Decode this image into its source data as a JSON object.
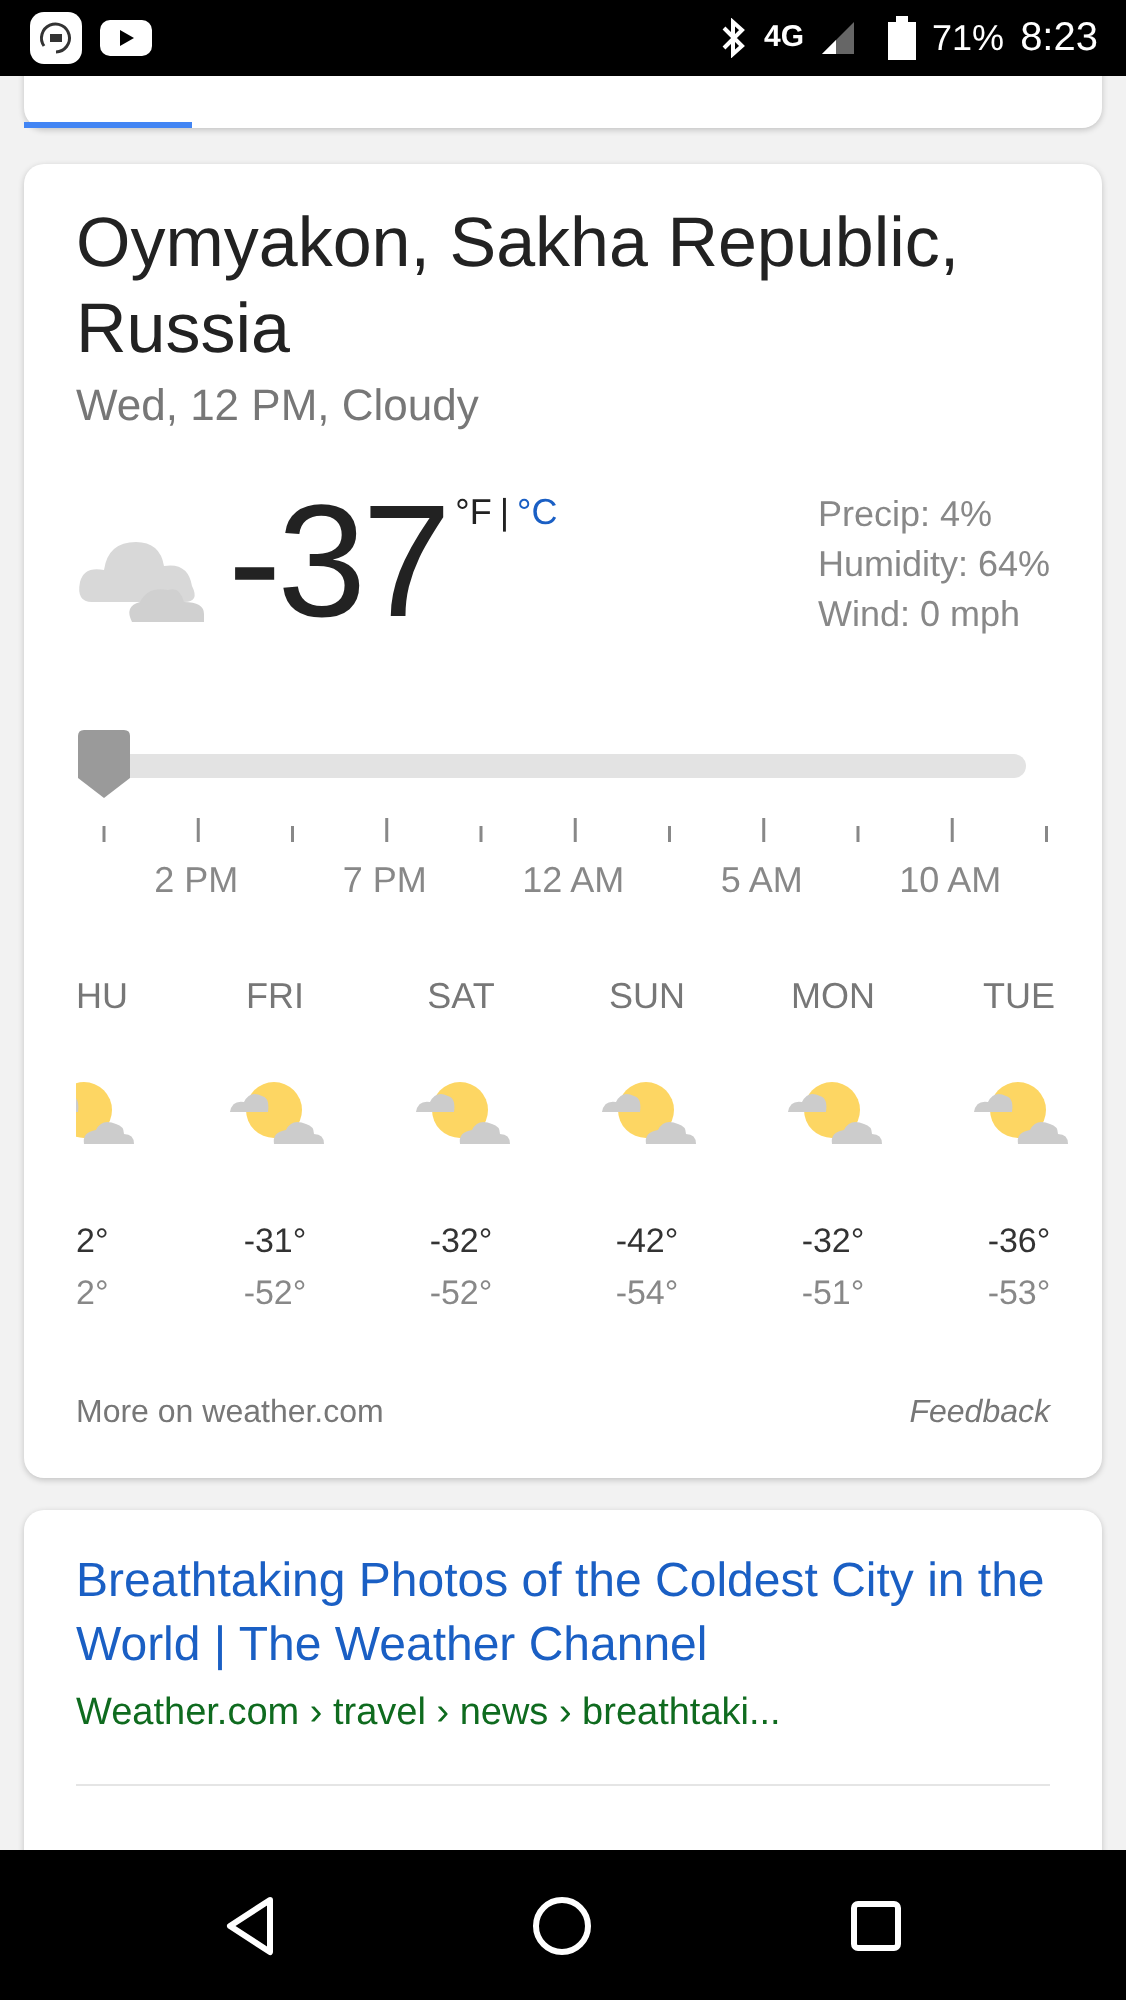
{
  "status_bar": {
    "battery": "71%",
    "time": "8:23",
    "network": "4G"
  },
  "weather": {
    "location": "Oymyakon, Sakha Republic, Russia",
    "subtitle": "Wed, 12 PM, Cloudy",
    "temperature": "-37",
    "unit_f": "°F",
    "unit_sep": "|",
    "unit_c": "°C",
    "details": [
      "Precip: 4%",
      "Humidity: 64%",
      "Wind: 0 mph"
    ],
    "slider": {
      "level": 0
    },
    "hours": [
      "2 PM",
      "7 PM",
      "12 AM",
      "5 AM",
      "10 AM"
    ],
    "days": [
      {
        "day": "HU",
        "high": "2°",
        "low": "2°"
      },
      {
        "day": "FRI",
        "high": "-31°",
        "low": "-52°"
      },
      {
        "day": "SAT",
        "high": "-32°",
        "low": "-52°"
      },
      {
        "day": "SUN",
        "high": "-42°",
        "low": "-54°"
      },
      {
        "day": "MON",
        "high": "-32°",
        "low": "-51°"
      },
      {
        "day": "TUE",
        "high": "-36°",
        "low": "-53°"
      }
    ],
    "more_link": "More on weather.com",
    "feedback": "Feedback"
  },
  "result": {
    "title": "Breathtaking Photos of the Coldest City in the World | The Weather Channel",
    "url": "Weather.com › travel › news › breathtaki..."
  }
}
